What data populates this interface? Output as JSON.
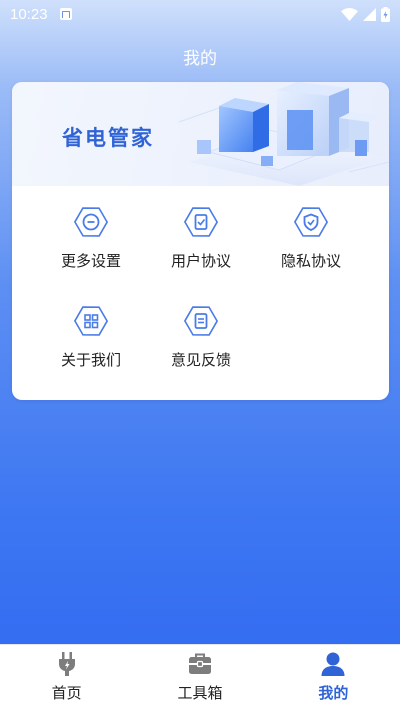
{
  "status_bar": {
    "time": "10:23",
    "icons": [
      "notification-icon",
      "wifi-icon",
      "signal-icon",
      "battery-icon"
    ]
  },
  "header": {
    "title": "我的"
  },
  "banner": {
    "brand": "省电管家",
    "art": "isometric-3d-blocks-illustration"
  },
  "menu": [
    {
      "label": "更多设置",
      "icon": "settings-icon"
    },
    {
      "label": "用户协议",
      "icon": "user-agreement-icon"
    },
    {
      "label": "隐私协议",
      "icon": "privacy-shield-icon"
    },
    {
      "label": "关于我们",
      "icon": "about-grid-icon"
    },
    {
      "label": "意见反馈",
      "icon": "feedback-doc-icon"
    }
  ],
  "bottom_nav": [
    {
      "label": "首页",
      "icon": "plug-icon",
      "active": false
    },
    {
      "label": "工具箱",
      "icon": "toolbox-icon",
      "active": false
    },
    {
      "label": "我的",
      "icon": "user-icon",
      "active": true
    }
  ],
  "colors": {
    "accent": "#2f63d6",
    "icon_blue": "#4a7ce8",
    "nav_gray": "#7d7d7d",
    "background_bottom": "#2f68f0"
  }
}
